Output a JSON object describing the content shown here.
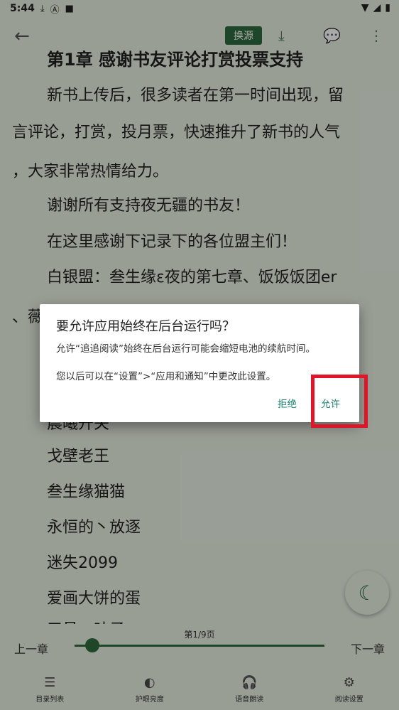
{
  "status": {
    "time": "5:44",
    "icons": [
      "download-icon",
      "a-icon",
      "square-icon"
    ],
    "right_icons": [
      "wifi-icon",
      "signal-icon",
      "battery-icon"
    ]
  },
  "topbar": {
    "source_label": "换源"
  },
  "reader": {
    "title": "第1章 感谢书友评论打赏投票支持",
    "lines": [
      "新书上传后，很多读者在第一时间出现，留",
      "言评论，打赏，投月票，快速推升了新书的人气",
      "，大家非常热情给力。",
      "谢谢所有支持夜无疆的书友！",
      "在这里感谢下记录下的各位盟主们！",
      "白银盟：叁生缘ε夜的第七章、饭饭饭团er",
      "、薇",
      "",
      "",
      "晨曦开关",
      "戈壁老王",
      "叁生缘猫猫",
      "永恒的丶放逐",
      "迷失2099",
      "爱画大饼的蛋",
      "三号一叶子"
    ]
  },
  "bottom": {
    "page_label": "第1/9页",
    "progress": 0.07,
    "prev_label": "上一章",
    "next_label": "下一章",
    "tabs": [
      {
        "label": "目录列表"
      },
      {
        "label": "护眼亮度"
      },
      {
        "label": "语音朗读"
      },
      {
        "label": "阅读设置"
      }
    ]
  },
  "dialog": {
    "title": "要允许应用始终在后台运行吗？",
    "message1": "允许“追追阅读”始终在后台运行可能会缩短电池的续航时间。",
    "message2": "您以后可以在“设置”>“应用和通知”中更改此设置。",
    "deny_label": "拒绝",
    "allow_label": "允许"
  },
  "colors": {
    "accent": "#2e6b3f",
    "background": "#e8f0e3",
    "highlight": "#e0152a",
    "dialog_button": "#1a7f6e"
  }
}
